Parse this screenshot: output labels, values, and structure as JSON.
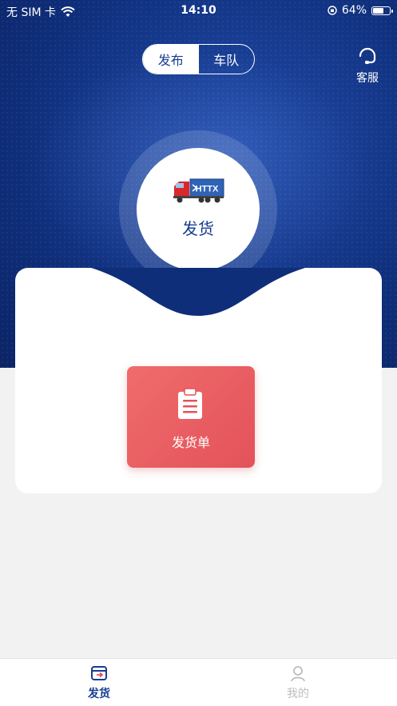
{
  "status_bar": {
    "carrier": "无 SIM 卡",
    "time": "14:10",
    "battery": "64%",
    "battery_level": 0.64
  },
  "segment": {
    "tabs": [
      {
        "label": "发布",
        "active": true
      },
      {
        "label": "车队",
        "active": false
      }
    ]
  },
  "customer_service": {
    "label": "客服",
    "icon": "headset-icon"
  },
  "hero": {
    "truck_logo_text": "HTTX",
    "action_label": "发货"
  },
  "card": {
    "button_label": "发货单",
    "button_icon": "clipboard-icon"
  },
  "tab_bar": {
    "items": [
      {
        "label": "发货",
        "icon": "shipment-box-icon",
        "active": true
      },
      {
        "label": "我的",
        "icon": "profile-icon",
        "active": false
      }
    ]
  },
  "colors": {
    "brand_blue": "#173c91",
    "action_red": "#e3525a"
  }
}
